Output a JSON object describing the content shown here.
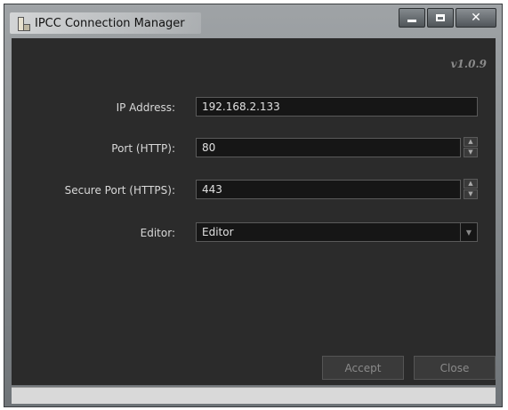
{
  "window": {
    "title": "IPCC Connection Manager"
  },
  "version": "v1.0.9",
  "form": {
    "ip": {
      "label": "IP Address:",
      "value": "192.168.2.133"
    },
    "http_port": {
      "label": "Port (HTTP):",
      "value": "80"
    },
    "https_port": {
      "label": "Secure Port (HTTPS):",
      "value": "443"
    },
    "editor": {
      "label": "Editor:",
      "value": "Editor"
    }
  },
  "buttons": {
    "accept": "Accept",
    "close": "Close"
  },
  "colors": {
    "client_bg": "#2b2b2b",
    "field_bg": "#161616",
    "text": "#d8d8d8"
  }
}
